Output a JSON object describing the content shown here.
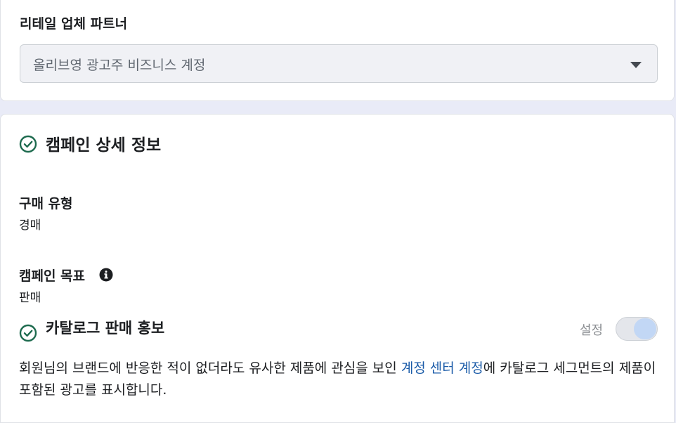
{
  "retail_partner": {
    "label": "리테일 업체 파트너",
    "selected_value": "올리브영 광고주 비즈니스 계정"
  },
  "campaign_details": {
    "title": "캠페인 상세 정보",
    "status_icon": "check-circle-icon",
    "purchase_type": {
      "label": "구매 유형",
      "value": "경매"
    },
    "objective": {
      "label": "캠페인 목표",
      "value": "판매",
      "info_icon": "info-icon"
    },
    "catalog_promotion": {
      "title": "카탈로그 판매 홍보",
      "status_icon": "check-circle-icon",
      "toggle_label": "설정",
      "toggle_on": true,
      "description_before": "회원님의 브랜드에 반응한 적이 없더라도 유사한 제품에 관심을 보인 ",
      "description_link": "계정 센터 계정",
      "description_after": "에 카탈로그 세그먼트의 제품이 포함된 광고를 표시합니다."
    }
  },
  "colors": {
    "accent_link": "#1a5ba8",
    "check_green": "#1e6b4f",
    "page_background": "#e9ebf7"
  }
}
